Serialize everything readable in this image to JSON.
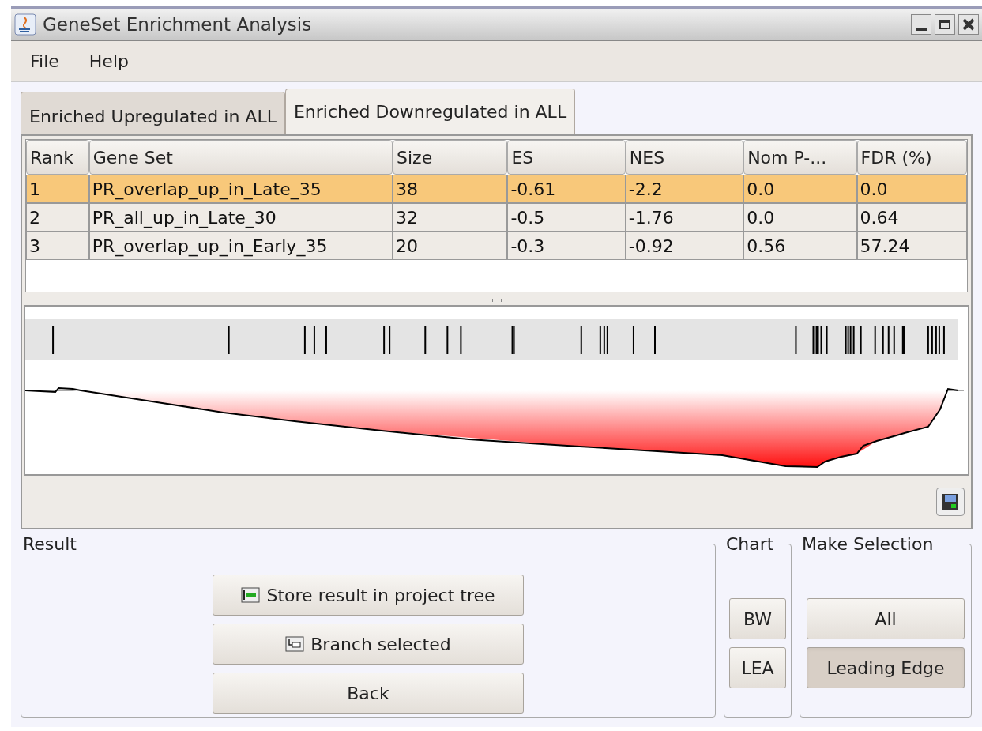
{
  "window": {
    "title": "GeneSet Enrichment Analysis"
  },
  "menu": [
    "File",
    "Help"
  ],
  "tabs": [
    {
      "label": "Enriched Upregulated in ALL",
      "selected": false
    },
    {
      "label": "Enriched Downregulated in ALL",
      "selected": true
    }
  ],
  "table": {
    "columns": [
      "Rank",
      "Gene Set",
      "Size",
      "ES",
      "NES",
      "Nom P-...",
      "FDR (%)"
    ],
    "rows": [
      {
        "selected": true,
        "cells": [
          "1",
          "PR_overlap_up_in_Late_35",
          "38",
          "-0.61",
          "-2.2",
          "0.0",
          "0.0"
        ]
      },
      {
        "selected": false,
        "cells": [
          "2",
          "PR_all_up_in_Late_30",
          "32",
          "-0.5",
          "-1.76",
          "0.0",
          "0.64"
        ]
      },
      {
        "selected": false,
        "cells": [
          "3",
          "PR_overlap_up_in_Early_35",
          "20",
          "-0.3",
          "-0.92",
          "0.56",
          "57.24"
        ]
      }
    ]
  },
  "result": {
    "title": "Result",
    "buttons": [
      {
        "label": "Store result in project tree",
        "kind": "store"
      },
      {
        "label": "Branch selected",
        "kind": "branch"
      },
      {
        "label": "Back",
        "kind": "plain"
      }
    ]
  },
  "chart_group": {
    "title": "Chart",
    "buttons": [
      "BW",
      "LEA"
    ]
  },
  "selection": {
    "title": "Make Selection",
    "buttons": [
      {
        "label": "All",
        "selected": false
      },
      {
        "label": "Leading Edge",
        "selected": true
      }
    ]
  }
}
